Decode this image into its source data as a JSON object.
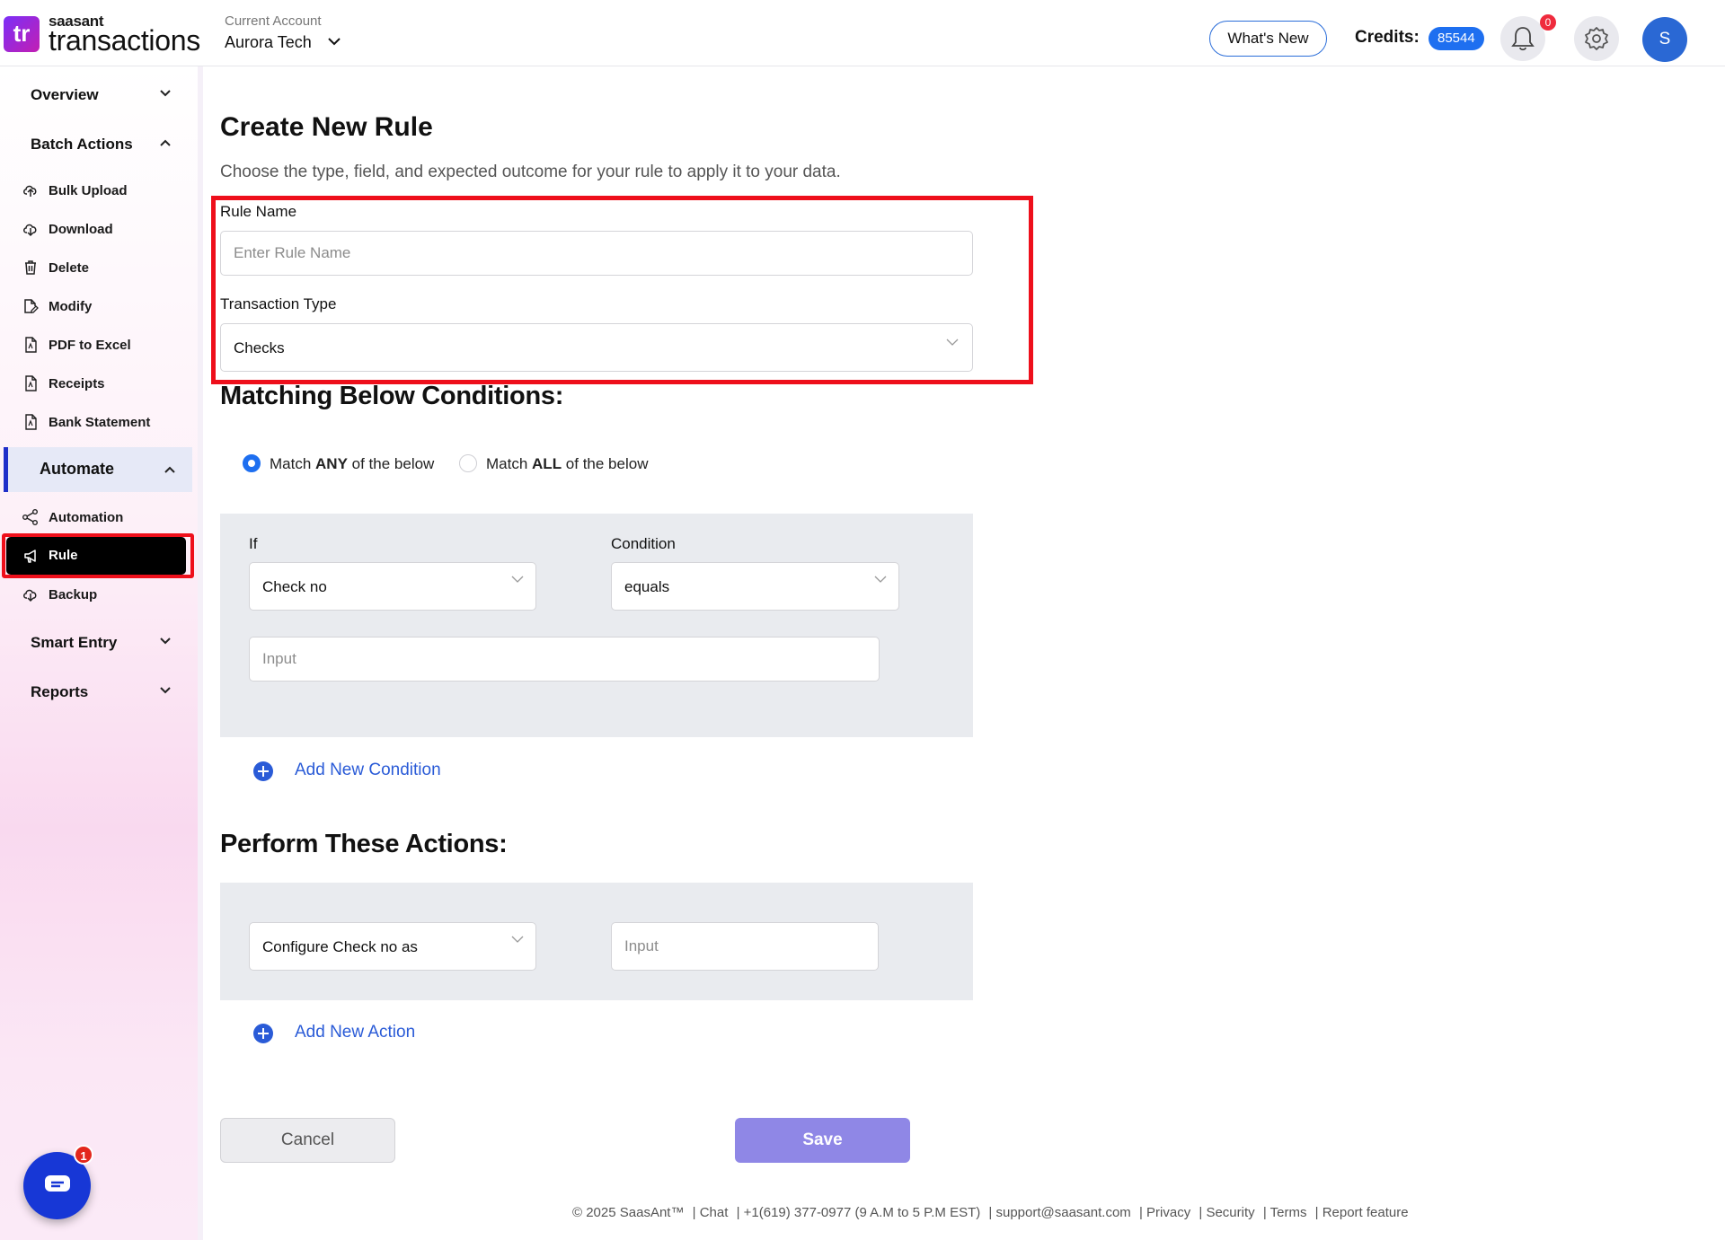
{
  "brand": {
    "logo_mark": "tr",
    "small": "saasant",
    "big": "transactions"
  },
  "account": {
    "label": "Current Account",
    "name": "Aurora Tech"
  },
  "header": {
    "whats_new": "What's New",
    "credits_label": "Credits:",
    "credits_value": "85544",
    "notifications": "0",
    "avatar_initial": "S"
  },
  "sidebar": {
    "overview": "Overview",
    "batch_actions": "Batch Actions",
    "batch_items": [
      "Bulk Upload",
      "Download",
      "Delete",
      "Modify",
      "PDF to Excel",
      "Receipts",
      "Bank Statement"
    ],
    "automate": "Automate",
    "automate_items": [
      "Automation",
      "Rule",
      "Backup"
    ],
    "smart_entry": "Smart Entry",
    "reports": "Reports",
    "chat_badge": "1"
  },
  "form": {
    "title": "Create New Rule",
    "subtitle": "Choose the type, field, and expected outcome for your rule to apply it to your data.",
    "rule_name_label": "Rule Name",
    "rule_name_placeholder": "Enter Rule Name",
    "transaction_type_label": "Transaction Type",
    "transaction_type_value": "Checks"
  },
  "conditions": {
    "heading": "Matching Below Conditions:",
    "match_any_pre": "Match ",
    "match_any_bold": "ANY",
    "match_any_post": " of the below",
    "match_all_pre": "Match ",
    "match_all_bold": "ALL",
    "match_all_post": " of the below",
    "if_label": "If",
    "condition_label": "Condition",
    "if_value": "Check no",
    "condition_value": "equals",
    "input_placeholder": "Input",
    "add_condition": "Add New Condition"
  },
  "actions": {
    "heading": "Perform These Actions:",
    "configure_value": "Configure Check no as",
    "input_placeholder": "Input",
    "add_action": "Add New Action"
  },
  "buttons": {
    "cancel": "Cancel",
    "save": "Save"
  },
  "footer": {
    "copyright": "© 2025 SaasAnt™",
    "chat": "| Chat",
    "phone": "| +1(619) 377-0977 (9 A.M to 5 P.M EST)",
    "email": "| support@saasant.com",
    "privacy": "| Privacy",
    "security": "| Security",
    "terms": "| Terms",
    "report": "| Report feature"
  },
  "colors": {
    "accent": "#1e6ff0",
    "highlight": "#ee0f1b",
    "save": "#8f87e6",
    "link": "#2a5bd7"
  }
}
